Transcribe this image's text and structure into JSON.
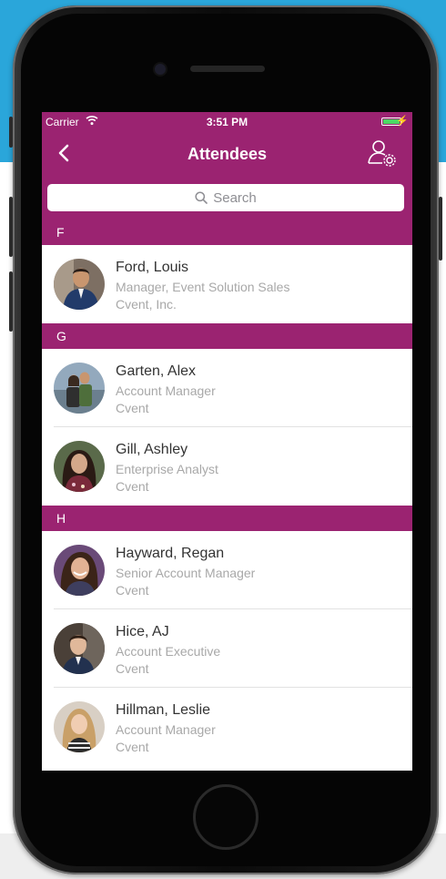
{
  "status_bar": {
    "carrier": "Carrier",
    "time": "3:51 PM"
  },
  "nav": {
    "title": "Attendees"
  },
  "search": {
    "placeholder": "Search"
  },
  "sections": [
    {
      "letter": "F",
      "rows": [
        {
          "name": "Ford, Louis",
          "title": "Manager, Event Solution Sales",
          "company": "Cvent, Inc."
        }
      ]
    },
    {
      "letter": "G",
      "rows": [
        {
          "name": "Garten, Alex",
          "title": "Account Manager",
          "company": "Cvent"
        },
        {
          "name": "Gill, Ashley",
          "title": "Enterprise Analyst",
          "company": "Cvent"
        }
      ]
    },
    {
      "letter": "H",
      "rows": [
        {
          "name": "Hayward, Regan",
          "title": "Senior Account Manager",
          "company": "Cvent"
        },
        {
          "name": "Hice, AJ",
          "title": "Account Executive",
          "company": "Cvent"
        },
        {
          "name": "Hillman, Leslie",
          "title": "Account Manager",
          "company": "Cvent"
        }
      ]
    }
  ],
  "colors": {
    "brand": "#9b2371",
    "background_accent": "#2aa6da"
  }
}
